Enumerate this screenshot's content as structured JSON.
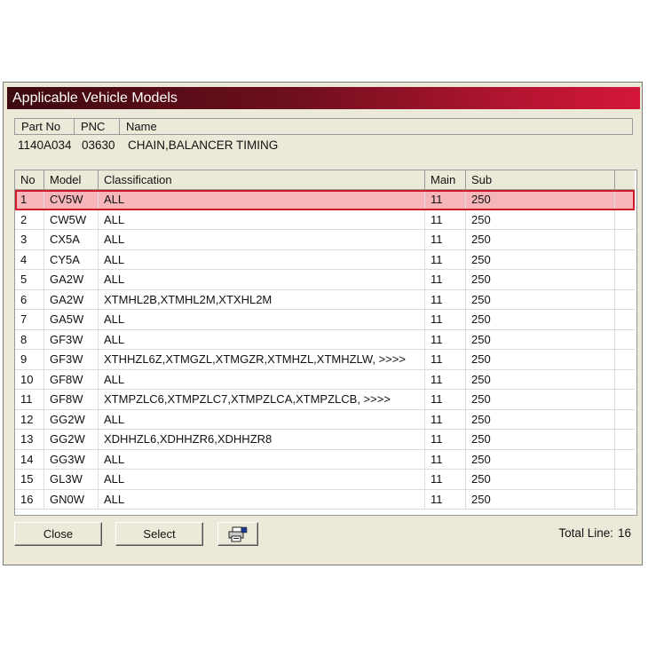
{
  "window": {
    "title": "Applicable Vehicle Models"
  },
  "part": {
    "headers": {
      "part_no": "Part No",
      "pnc": "PNC",
      "name": "Name"
    },
    "part_no": "1140A034",
    "pnc": "03630",
    "name": "CHAIN,BALANCER TIMING"
  },
  "table": {
    "headers": {
      "no": "No",
      "model": "Model",
      "classification": "Classification",
      "main": "Main",
      "sub": "Sub"
    },
    "selected_index": 0,
    "rows": [
      {
        "no": "1",
        "model": "CV5W",
        "classification": "ALL",
        "main": "11",
        "sub": "250"
      },
      {
        "no": "2",
        "model": "CW5W",
        "classification": "ALL",
        "main": "11",
        "sub": "250"
      },
      {
        "no": "3",
        "model": "CX5A",
        "classification": "ALL",
        "main": "11",
        "sub": "250"
      },
      {
        "no": "4",
        "model": "CY5A",
        "classification": "ALL",
        "main": "11",
        "sub": "250"
      },
      {
        "no": "5",
        "model": "GA2W",
        "classification": "ALL",
        "main": "11",
        "sub": "250"
      },
      {
        "no": "6",
        "model": "GA2W",
        "classification": "XTMHL2B,XTMHL2M,XTXHL2M",
        "main": "11",
        "sub": "250"
      },
      {
        "no": "7",
        "model": "GA5W",
        "classification": "ALL",
        "main": "11",
        "sub": "250"
      },
      {
        "no": "8",
        "model": "GF3W",
        "classification": "ALL",
        "main": "11",
        "sub": "250"
      },
      {
        "no": "9",
        "model": "GF3W",
        "classification": "XTHHZL6Z,XTMGZL,XTMGZR,XTMHZL,XTMHZLW,  >>>>",
        "main": "11",
        "sub": "250"
      },
      {
        "no": "10",
        "model": "GF8W",
        "classification": "ALL",
        "main": "11",
        "sub": "250"
      },
      {
        "no": "11",
        "model": "GF8W",
        "classification": "XTMPZLC6,XTMPZLC7,XTMPZLCA,XTMPZLCB,  >>>>",
        "main": "11",
        "sub": "250"
      },
      {
        "no": "12",
        "model": "GG2W",
        "classification": "ALL",
        "main": "11",
        "sub": "250"
      },
      {
        "no": "13",
        "model": "GG2W",
        "classification": "XDHHZL6,XDHHZR6,XDHHZR8",
        "main": "11",
        "sub": "250"
      },
      {
        "no": "14",
        "model": "GG3W",
        "classification": "ALL",
        "main": "11",
        "sub": "250"
      },
      {
        "no": "15",
        "model": "GL3W",
        "classification": "ALL",
        "main": "11",
        "sub": "250"
      },
      {
        "no": "16",
        "model": "GN0W",
        "classification": "ALL",
        "main": "11",
        "sub": "250"
      }
    ]
  },
  "buttons": {
    "close": "Close",
    "select": "Select",
    "print_icon": "printer-icon"
  },
  "footer": {
    "total_label": "Total Line:",
    "total_value": "16"
  },
  "colors": {
    "title_dark": "#3c0a10",
    "title_light": "#d4163a",
    "selected_row": "#f6b6b9",
    "selected_border": "#d11a2a"
  }
}
